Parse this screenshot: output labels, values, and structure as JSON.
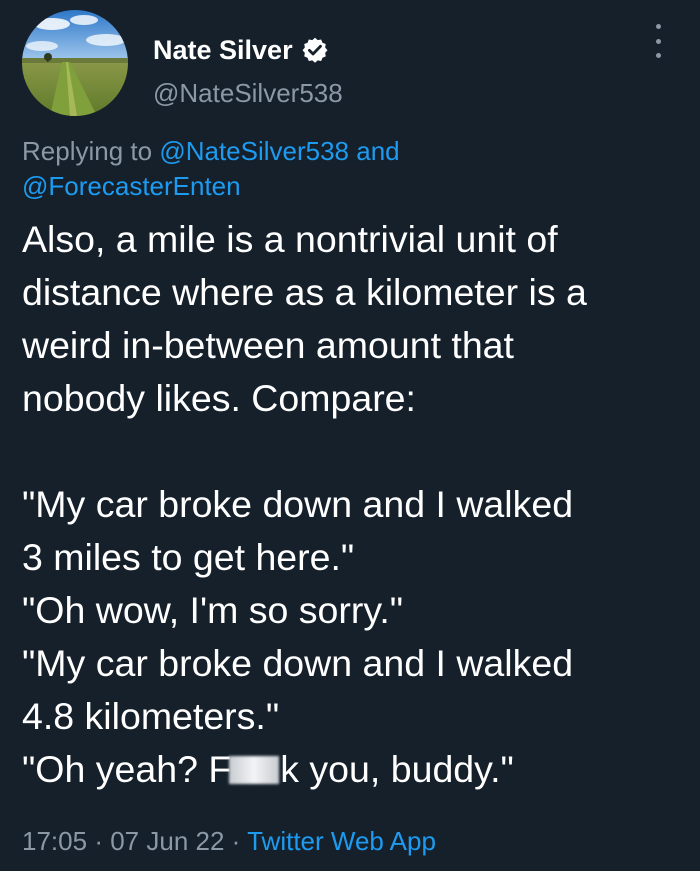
{
  "author": {
    "name": "Nate Silver",
    "handle": "@NateSilver538",
    "verified": true,
    "verified_icon": "verified-badge-icon",
    "avatar": "landscape-photo-avatar"
  },
  "reply": {
    "prefix": "Replying to",
    "mention1": "@NateSilver538",
    "conjunction": "and",
    "mention2": "@ForecasterEnten"
  },
  "tweet": {
    "lines": [
      "Also, a mile is a nontrivial unit of",
      "distance where as a kilometer is a",
      "weird in-between amount that",
      "nobody likes. Compare:",
      "\"My car broke down and I walked",
      "3 miles to get here.\"",
      "\"Oh wow, I'm so sorry.\"",
      "\"My car broke down and I walked",
      "4.8 kilometers.\"",
      "\"Oh yeah? F",
      "k you, buddy.\""
    ]
  },
  "meta": {
    "time": "17:05",
    "separator": "·",
    "date": "07 Jun 22",
    "source": "Twitter Web App"
  },
  "colors": {
    "background": "#15202b",
    "text": "#ffffff",
    "secondary": "#8b98a5",
    "link": "#1d9bf0"
  }
}
